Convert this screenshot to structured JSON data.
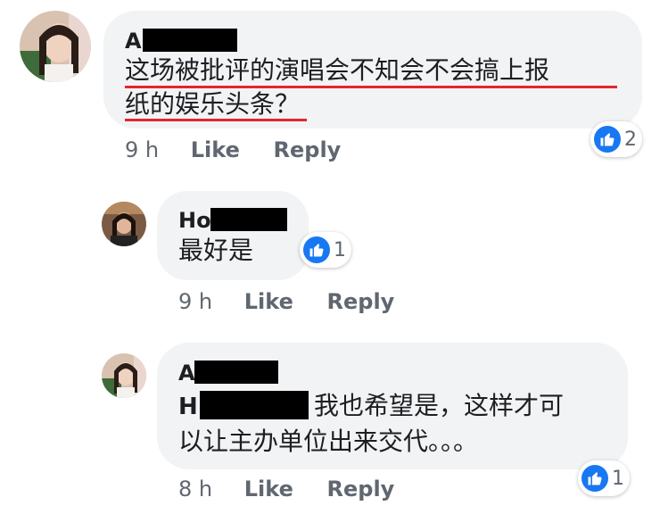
{
  "comments": [
    {
      "author": "A",
      "text_lines": [
        "这场被批评的演唱会不知会不会搞上报",
        "纸的娱乐头条？"
      ],
      "time": "9 h",
      "like_label": "Like",
      "reply_label": "Reply",
      "reaction_icon": "thumbs-up-icon",
      "reaction_count": "2"
    },
    {
      "author": "Ho",
      "text_lines": [
        "最好是"
      ],
      "time": "9 h",
      "like_label": "Like",
      "reply_label": "Reply",
      "reaction_icon": "thumbs-up-icon",
      "reaction_count": "1"
    },
    {
      "author": "A",
      "mention": "H",
      "text_lines": [
        "我也希望是，这样才可",
        "以让主办单位出来交代。。。"
      ],
      "time": "8 h",
      "like_label": "Like",
      "reply_label": "Reply",
      "reaction_icon": "thumbs-up-icon",
      "reaction_count": "1"
    }
  ],
  "colors": {
    "like_blue": "#1877f2",
    "bubble": "#f2f3f5",
    "underline_red": "#e0282e",
    "meta_gray": "#606770"
  }
}
